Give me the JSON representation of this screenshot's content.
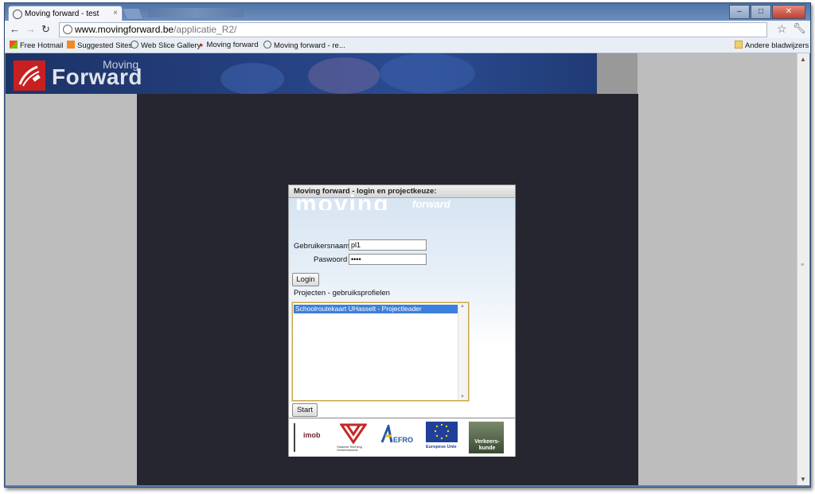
{
  "browser": {
    "tab_title": "Moving forward - test",
    "tab_close": "×",
    "url_host": "www.movingforward.be",
    "url_path": "/applicatie_R2/",
    "bookmarks": [
      "Free Hotmail",
      "Suggested Sites",
      "Web Slice Gallery",
      "Moving forward",
      "Moving forward - re..."
    ],
    "other_bookmarks": "Andere bladwijzers",
    "nav_icons": [
      "back-icon",
      "forward-icon",
      "reload-icon"
    ],
    "window_buttons": [
      "minimize",
      "maximize",
      "close"
    ]
  },
  "site": {
    "logo_small": "Moving",
    "logo_big": "Forward"
  },
  "login": {
    "title": "Moving forward - login en projectkeuze:",
    "watermark": "moving",
    "watermark_small": "forward",
    "username_label": "Gebruikersnaam",
    "username_value": "pl1",
    "password_label": "Paswoord",
    "password_value": "••••",
    "login_button": "Login",
    "projects_label": "Projecten - gebruiksprofielen",
    "projects": [
      "Schoolroutekaart UHasselt - Projectleader"
    ],
    "start_button": "Start"
  },
  "footer": {
    "logo_labels": [
      "imob",
      "Vlaamse Stichting Verkeerskunde",
      "EFRO",
      "Europese Unie",
      "Verkeers-kunde"
    ]
  },
  "colors": {
    "header": "#243f7e",
    "panel": "#262631",
    "selection": "#3d7fdc",
    "logo_red": "#c82020"
  }
}
